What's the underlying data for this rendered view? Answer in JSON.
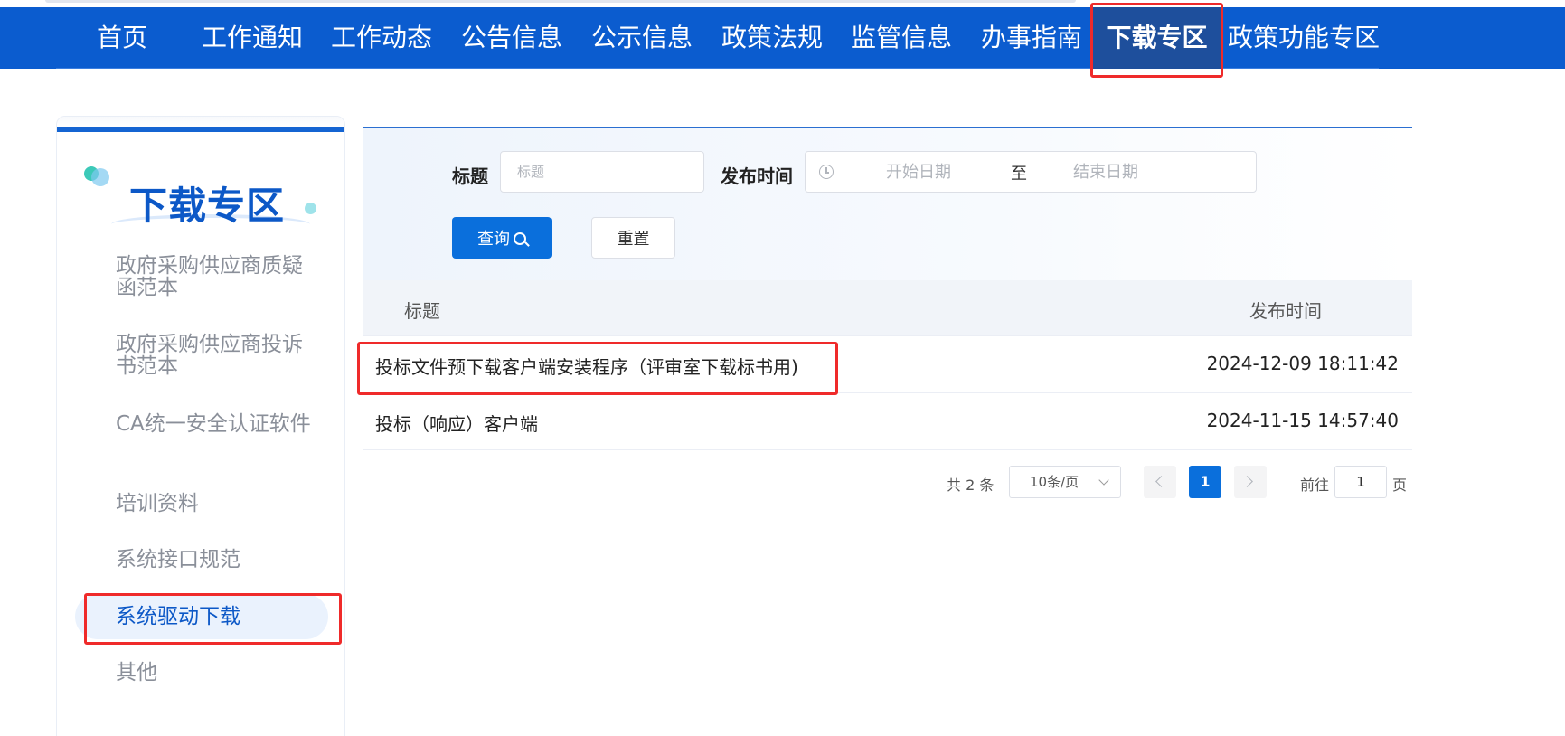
{
  "nav": {
    "items": [
      {
        "label": "首页"
      },
      {
        "label": "工作通知"
      },
      {
        "label": "工作动态"
      },
      {
        "label": "公告信息"
      },
      {
        "label": "公示信息"
      },
      {
        "label": "政策法规"
      },
      {
        "label": "监管信息"
      },
      {
        "label": "办事指南"
      },
      {
        "label": "下载专区",
        "active": true
      },
      {
        "label": "政策功能专区"
      }
    ]
  },
  "sidebar": {
    "title": "下载专区",
    "items": [
      {
        "label": "政府采购供应商质疑函范本"
      },
      {
        "label": "政府采购供应商投诉书范本"
      },
      {
        "label": "CA统一安全认证软件"
      },
      {
        "label": "培训资料"
      },
      {
        "label": "系统接口规范"
      },
      {
        "label": "系统驱动下载",
        "active": true
      },
      {
        "label": "其他"
      }
    ]
  },
  "filter": {
    "title_label": "标题",
    "title_placeholder": "标题",
    "date_label": "发布时间",
    "start_placeholder": "开始日期",
    "separator": "至",
    "end_placeholder": "结束日期",
    "search_button": "查询",
    "reset_button": "重置"
  },
  "table": {
    "columns": [
      "标题",
      "发布时间"
    ],
    "rows": [
      {
        "title": "投标文件预下载客户端安装程序（评审室下载标书用)",
        "date": "2024-12-09 18:11:42"
      },
      {
        "title": "投标（响应）客户端",
        "date": "2024-11-15 14:57:40"
      }
    ]
  },
  "pagination": {
    "total_text": "共 2 条",
    "page_size": "10条/页",
    "current_page": "1",
    "goto_label": "前往",
    "goto_value": "1",
    "page_suffix": "页"
  },
  "colors": {
    "nav_bg": "#0b5ccf",
    "nav_active": "#1e4f9c",
    "primary": "#0a6fdc",
    "highlight_box": "#ef2a2a"
  }
}
